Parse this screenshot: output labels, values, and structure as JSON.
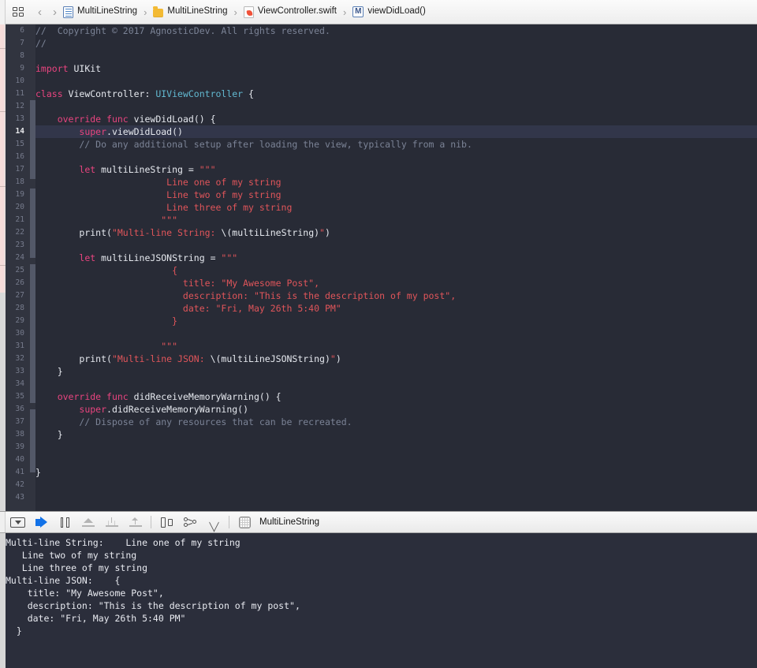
{
  "window": {
    "title": "MultiLineString — ViewController.swift"
  },
  "jumpbar": {
    "related_files_icon": "related-items-icon",
    "back_arrow": "‹",
    "forward_arrow": "›",
    "separator": "›",
    "crumbs": [
      {
        "label": "MultiLineString",
        "icon": "project-icon"
      },
      {
        "label": "MultiLineString",
        "icon": "folder-icon"
      },
      {
        "label": "ViewController.swift",
        "icon": "swift-file-icon"
      },
      {
        "label": "viewDidLoad()",
        "icon": "method-icon",
        "badge": "M"
      }
    ]
  },
  "editor": {
    "current_line": 14,
    "first_visible_line": 6,
    "last_visible_line": 43,
    "colors": {
      "background": "#282b36",
      "gutter": "#31343f",
      "current_line_highlight": "#32364a",
      "keyword": "#e8447f",
      "type": "#62b8d0",
      "plain": "#e6e9ef",
      "comment": "#7b8396",
      "string": "#e0555a",
      "line_number": "#767b8c",
      "modification_bar": "#535868"
    },
    "lines": [
      {
        "n": 6,
        "tokens": [
          {
            "t": "//  Copyright © 2017 AgnosticDev. All rights reserved.",
            "c": "cmt"
          }
        ]
      },
      {
        "n": 7,
        "tokens": [
          {
            "t": "//",
            "c": "cmt"
          }
        ]
      },
      {
        "n": 8,
        "tokens": []
      },
      {
        "n": 9,
        "tokens": [
          {
            "t": "import",
            "c": "kw"
          },
          {
            "t": " ",
            "c": "plain"
          },
          {
            "t": "UIKit",
            "c": "plain"
          }
        ]
      },
      {
        "n": 10,
        "tokens": []
      },
      {
        "n": 11,
        "tokens": [
          {
            "t": "class",
            "c": "kw"
          },
          {
            "t": " ViewController: ",
            "c": "plain"
          },
          {
            "t": "UIViewController",
            "c": "type"
          },
          {
            "t": " {",
            "c": "plain"
          }
        ]
      },
      {
        "n": 12,
        "tokens": []
      },
      {
        "n": 13,
        "tokens": [
          {
            "t": "    ",
            "c": "plain"
          },
          {
            "t": "override",
            "c": "kw"
          },
          {
            "t": " ",
            "c": "plain"
          },
          {
            "t": "func",
            "c": "kw"
          },
          {
            "t": " viewDidLoad() {",
            "c": "plain"
          }
        ]
      },
      {
        "n": 14,
        "tokens": [
          {
            "t": "        ",
            "c": "plain"
          },
          {
            "t": "super",
            "c": "kw"
          },
          {
            "t": ".viewDidLoad()",
            "c": "plain"
          }
        ]
      },
      {
        "n": 15,
        "tokens": [
          {
            "t": "        // Do any additional setup after loading the view, typically from a nib.",
            "c": "cmt"
          }
        ]
      },
      {
        "n": 16,
        "tokens": []
      },
      {
        "n": 17,
        "tokens": [
          {
            "t": "        ",
            "c": "plain"
          },
          {
            "t": "let",
            "c": "kw"
          },
          {
            "t": " multiLineString = ",
            "c": "plain"
          },
          {
            "t": "\"\"\"",
            "c": "str"
          }
        ]
      },
      {
        "n": 18,
        "tokens": [
          {
            "t": "                        Line one of my string",
            "c": "str"
          }
        ]
      },
      {
        "n": 19,
        "tokens": [
          {
            "t": "                        Line two of my string",
            "c": "str"
          }
        ]
      },
      {
        "n": 20,
        "tokens": [
          {
            "t": "                        Line three of my string",
            "c": "str"
          }
        ]
      },
      {
        "n": 21,
        "tokens": [
          {
            "t": "                       \"\"\"",
            "c": "str"
          }
        ]
      },
      {
        "n": 22,
        "tokens": [
          {
            "t": "        print(",
            "c": "plain"
          },
          {
            "t": "\"Multi-line String: ",
            "c": "str"
          },
          {
            "t": "\\(multiLineString)",
            "c": "plain"
          },
          {
            "t": "\"",
            "c": "str"
          },
          {
            "t": ")",
            "c": "plain"
          }
        ]
      },
      {
        "n": 23,
        "tokens": []
      },
      {
        "n": 24,
        "tokens": [
          {
            "t": "        ",
            "c": "plain"
          },
          {
            "t": "let",
            "c": "kw"
          },
          {
            "t": " multiLineJSONString = ",
            "c": "plain"
          },
          {
            "t": "\"\"\"",
            "c": "str"
          }
        ]
      },
      {
        "n": 25,
        "tokens": [
          {
            "t": "                         {",
            "c": "str"
          }
        ]
      },
      {
        "n": 26,
        "tokens": [
          {
            "t": "                           title: \"My Awesome Post\",",
            "c": "str"
          }
        ]
      },
      {
        "n": 27,
        "tokens": [
          {
            "t": "                           description: \"This is the description of my post\",",
            "c": "str"
          }
        ]
      },
      {
        "n": 28,
        "tokens": [
          {
            "t": "                           date: \"Fri, May 26th 5:40 PM\"",
            "c": "str"
          }
        ]
      },
      {
        "n": 29,
        "tokens": [
          {
            "t": "                         }",
            "c": "str"
          }
        ]
      },
      {
        "n": 30,
        "tokens": []
      },
      {
        "n": 31,
        "tokens": [
          {
            "t": "                       \"\"\"",
            "c": "str"
          }
        ]
      },
      {
        "n": 32,
        "tokens": [
          {
            "t": "        print(",
            "c": "plain"
          },
          {
            "t": "\"Multi-line JSON: ",
            "c": "str"
          },
          {
            "t": "\\(multiLineJSONString)",
            "c": "plain"
          },
          {
            "t": "\"",
            "c": "str"
          },
          {
            "t": ")",
            "c": "plain"
          }
        ]
      },
      {
        "n": 33,
        "tokens": [
          {
            "t": "    }",
            "c": "plain"
          }
        ]
      },
      {
        "n": 34,
        "tokens": []
      },
      {
        "n": 35,
        "tokens": [
          {
            "t": "    ",
            "c": "plain"
          },
          {
            "t": "override",
            "c": "kw"
          },
          {
            "t": " ",
            "c": "plain"
          },
          {
            "t": "func",
            "c": "kw"
          },
          {
            "t": " didReceiveMemoryWarning() {",
            "c": "plain"
          }
        ]
      },
      {
        "n": 36,
        "tokens": [
          {
            "t": "        ",
            "c": "plain"
          },
          {
            "t": "super",
            "c": "kw"
          },
          {
            "t": ".didReceiveMemoryWarning()",
            "c": "plain"
          }
        ]
      },
      {
        "n": 37,
        "tokens": [
          {
            "t": "        // Dispose of any resources that can be recreated.",
            "c": "cmt"
          }
        ]
      },
      {
        "n": 38,
        "tokens": [
          {
            "t": "    }",
            "c": "plain"
          }
        ]
      },
      {
        "n": 39,
        "tokens": []
      },
      {
        "n": 40,
        "tokens": []
      },
      {
        "n": 41,
        "tokens": [
          {
            "t": "}",
            "c": "plain"
          }
        ]
      },
      {
        "n": 42,
        "tokens": []
      },
      {
        "n": 43,
        "tokens": []
      }
    ]
  },
  "debugbar": {
    "buttons": [
      {
        "name": "hide-debug-area-button",
        "icon": "panel-toggle-icon",
        "tooltip": "Hide the Debug area"
      },
      {
        "name": "continue-button",
        "icon": "continue-icon",
        "tooltip": "Continue program execution"
      },
      {
        "name": "pause-button",
        "icon": "pause-icon",
        "tooltip": "Pause program execution"
      },
      {
        "name": "step-over-button",
        "icon": "step-over-icon",
        "tooltip": "Step over"
      },
      {
        "name": "step-into-button",
        "icon": "step-into-icon",
        "tooltip": "Step into"
      },
      {
        "name": "step-out-button",
        "icon": "step-out-icon",
        "tooltip": "Step out"
      },
      {
        "name": "view-debugging-button",
        "icon": "view-hierarchy-icon",
        "tooltip": "Debug View Hierarchy"
      },
      {
        "name": "memory-graph-button",
        "icon": "memory-graph-icon",
        "tooltip": "Debug Memory Graph"
      },
      {
        "name": "simulate-location-button",
        "icon": "location-arrow-icon",
        "tooltip": "Simulate Location"
      }
    ],
    "scheme": {
      "icon": "app-icon",
      "label": "MultiLineString"
    }
  },
  "console": {
    "output": "Multi-line String:    Line one of my string\n   Line two of my string\n   Line three of my string\nMulti-line JSON:    {\n    title: \"My Awesome Post\",\n    description: \"This is the description of my post\",\n    date: \"Fri, May 26th 5:40 PM\"\n  }"
  }
}
